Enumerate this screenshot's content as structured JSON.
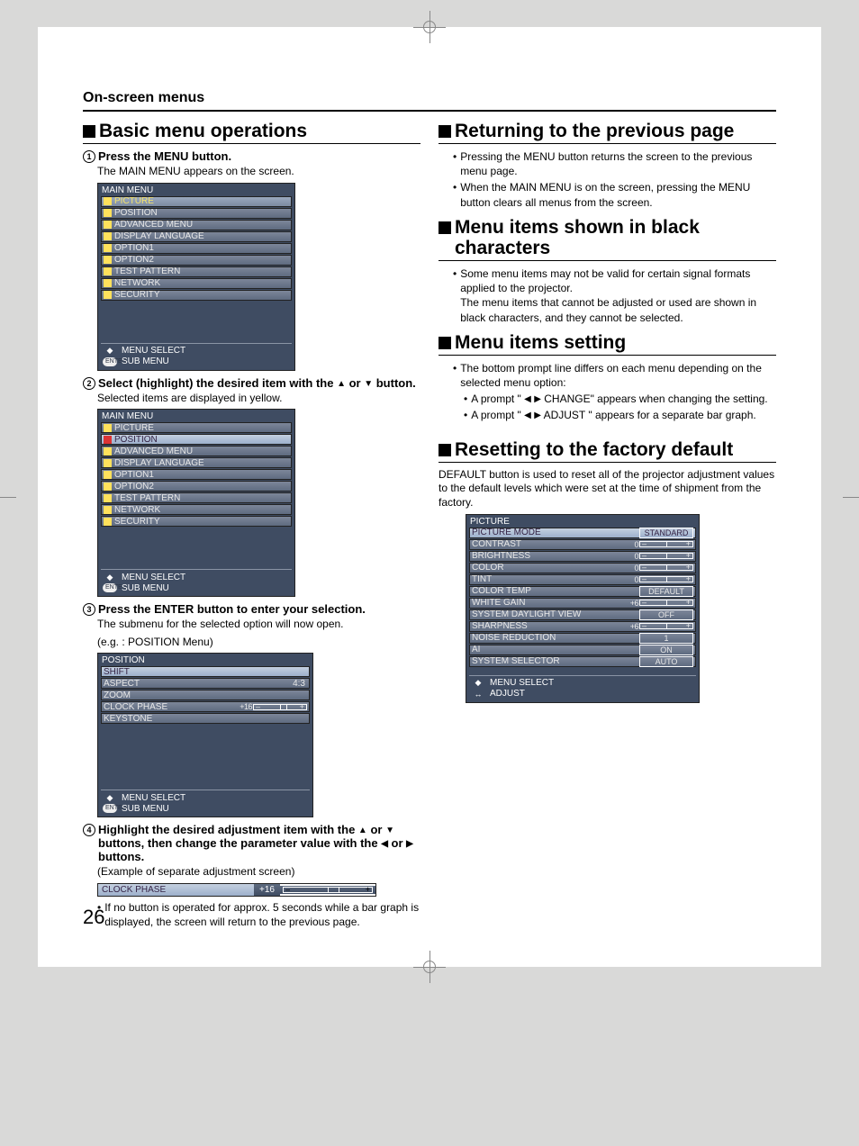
{
  "header": "On-screen menus",
  "page_number": "26",
  "left": {
    "title": "Basic menu operations",
    "step1": {
      "label": "Press the MENU button.",
      "desc": "The MAIN MENU appears on the screen."
    },
    "step2": {
      "label_a": "Select (highlight) the desired item with the ",
      "label_b": " or ",
      "label_c": " button.",
      "desc": "Selected items are displayed in yellow."
    },
    "step3": {
      "label": "Press the ENTER button to enter your selection.",
      "desc1": "The submenu for the selected option will now open.",
      "desc2": "(e.g. : POSITION Menu)"
    },
    "step4": {
      "label_a": "Highlight the desired adjustment item with the ",
      "label_b": " or ",
      "label_c": " buttons, then change the parameter value with the ",
      "label_d": " or ",
      "label_e": " buttons.",
      "example": "(Example of separate adjustment screen)",
      "note": "If no button is operated for approx. 5 seconds while a bar graph is displayed, the screen will return to the previous page."
    },
    "main_menu": {
      "title": "MAIN MENU",
      "items": [
        "PICTURE",
        "POSITION",
        "ADVANCED MENU",
        "DISPLAY LANGUAGE",
        "OPTION1",
        "OPTION2",
        "TEST PATTERN",
        "NETWORK",
        "SECURITY"
      ],
      "footer1": "MENU SELECT",
      "footer2": "SUB MENU"
    },
    "position_menu": {
      "title": "POSITION",
      "items": [
        {
          "name": "SHIFT"
        },
        {
          "name": "ASPECT",
          "val": "4:3"
        },
        {
          "name": "ZOOM"
        },
        {
          "name": "CLOCK PHASE",
          "val": "+16",
          "slider": true
        },
        {
          "name": "KEYSTONE"
        }
      ],
      "footer1": "MENU SELECT",
      "footer2": "SUB MENU"
    },
    "adj": {
      "name": "CLOCK PHASE",
      "val": "+16"
    }
  },
  "right": {
    "sec1": {
      "title": "Returning to the previous page",
      "b1": "Pressing the MENU button returns the screen to the previous menu page.",
      "b2": "When the MAIN MENU is on the screen, pressing the MENU button clears all menus from the screen."
    },
    "sec2": {
      "title": "Menu items shown in black characters",
      "b1": "Some menu items may not be valid for certain signal formats applied to the projector.\nThe menu items that cannot be adjusted or used are shown in black characters, and they cannot be selected."
    },
    "sec3": {
      "title": "Menu items setting",
      "b1": "The bottom prompt line differs on each menu depending on the selected menu option:",
      "sb1a": "A prompt \" ",
      "sb1b": " CHANGE\" appears when changing the setting.",
      "sb2a": "A prompt \" ",
      "sb2b": " ADJUST \" appears for a separate bar graph."
    },
    "sec4": {
      "title": "Resetting to the factory default",
      "body": "DEFAULT button is used to reset all of the projector adjustment values to the default levels which were set at the time of shipment from the factory."
    },
    "picture_menu": {
      "title": "PICTURE",
      "items": [
        {
          "name": "PICTURE MODE",
          "val": "STANDARD",
          "box": true
        },
        {
          "name": "CONTRAST",
          "val": "0",
          "slider": true
        },
        {
          "name": "BRIGHTNESS",
          "val": "0",
          "slider": true
        },
        {
          "name": "COLOR",
          "val": "0",
          "slider": true
        },
        {
          "name": "TINT",
          "val": "0",
          "slider": true
        },
        {
          "name": "COLOR TEMP",
          "val": "DEFAULT",
          "box": true
        },
        {
          "name": "WHITE GAIN",
          "val": "+6",
          "slider": true
        },
        {
          "name": "SYSTEM DAYLIGHT VIEW",
          "val": "OFF",
          "box": true
        },
        {
          "name": "SHARPNESS",
          "val": "+6",
          "slider": true
        },
        {
          "name": "NOISE REDUCTION",
          "val": "1",
          "box": true
        },
        {
          "name": "AI",
          "val": "ON",
          "box": true
        },
        {
          "name": "SYSTEM SELECTOR",
          "val": "AUTO",
          "box": true
        }
      ],
      "footer1": "MENU SELECT",
      "footer2": "ADJUST"
    }
  }
}
